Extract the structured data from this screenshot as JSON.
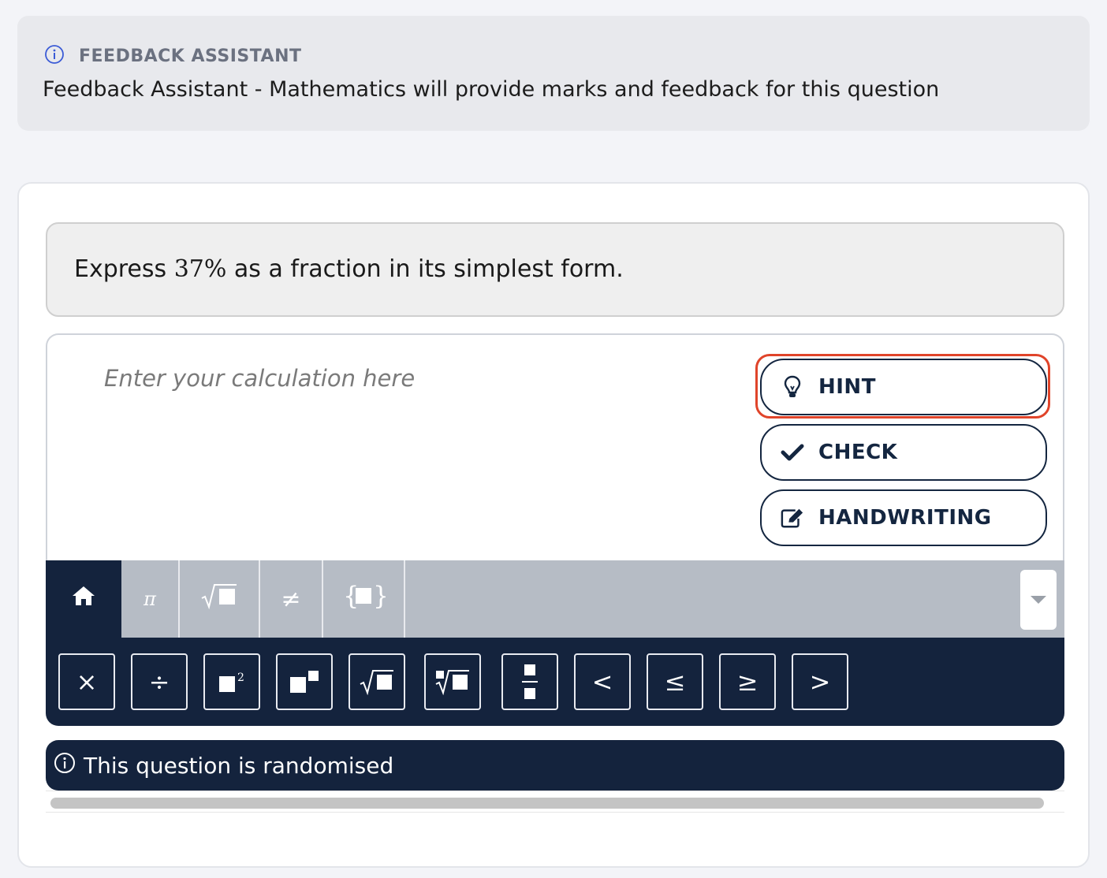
{
  "feedback_notice": {
    "title": "FEEDBACK ASSISTANT",
    "text": "Feedback Assistant - Mathematics will provide marks and feedback for this question",
    "icon": "info-icon"
  },
  "question": {
    "prefix": "Express ",
    "math": "37%",
    "suffix": " as a fraction in its simplest form."
  },
  "answer": {
    "placeholder": "Enter your calculation here"
  },
  "buttons": {
    "hint": "HINT",
    "check": "CHECK",
    "handwriting": "HANDWRITING"
  },
  "keyboard_tabs": [
    {
      "icon": "home-icon",
      "active": true
    },
    {
      "label": "π"
    },
    {
      "label": "√■"
    },
    {
      "label": "≠"
    },
    {
      "label": "{■}"
    }
  ],
  "keys": {
    "times": "×",
    "divide": "÷",
    "less": "<",
    "less_equal": "≤",
    "greater_equal": "≥",
    "greater": ">"
  },
  "randomised_note": "This question is randomised",
  "colors": {
    "navy": "#14233d",
    "highlight": "#e0442a",
    "tab_gray": "#b6bcc5"
  }
}
